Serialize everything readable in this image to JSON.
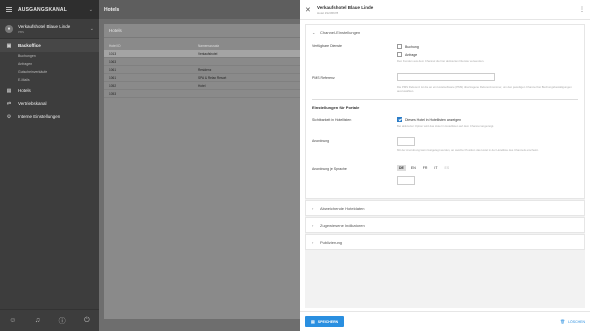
{
  "sidebar": {
    "title": "AUSGANGSKANAL",
    "hotel_name": "Verkaufshotel Blaue Linde",
    "hotel_sub": "PBS",
    "backoffice": "Backoffice",
    "sub_items": [
      "Buchungen",
      "Anfragen",
      "Gutscheinverkäufe",
      "E-Mails"
    ],
    "hotels": "Hotels",
    "vertriebskanal": "Vertriebskanal",
    "interne": "Interne Einstellungen"
  },
  "main": {
    "title": "Hotels",
    "card_title": "Hotels",
    "col_id": "Hotel ID",
    "col_name": "Namenszusatz",
    "rows": [
      {
        "id": "1013",
        "name": "Verkaufshotel"
      },
      {
        "id": "1063",
        "name": ""
      },
      {
        "id": "1061",
        "name": "Residenz"
      },
      {
        "id": "1061",
        "name": "SPA & Relax Resort"
      },
      {
        "id": "1052",
        "name": "Hotel"
      },
      {
        "id": "1053",
        "name": ""
      }
    ]
  },
  "panel": {
    "name": "Verkaufshotel Blaue Linde",
    "sub": "Hotel #1245678",
    "acc1": "Channel-Einstellungen",
    "verfuegbare_dienste": "Verfügbare Dienste",
    "opt_buchung": "Buchung",
    "opt_anfrage": "Anfrage",
    "dienste_hint": "Den Kunden aus dem Channel die hier aktivierten Dienste verwenden.",
    "pms_label": "PMS Referenz",
    "pms_hint": "Die PMS Referenz ist die an ein Hotelsoftware (PMS) übertragene Referenznummer, um den jeweiligen Channel bei Buchungsbestätigungen auszuwählen.",
    "portale_title": "Einstellungen für Portale",
    "sichtbarkeit_label": "Sichtbarkeit in Hotellisten",
    "sichtbarkeit_opt": "Dieses Hotel in Hotellisten anzeigen",
    "sichtbarkeit_hint": "Bei aktivierter Option wird das Hotel in Hotellisten auf dem Channel angezeigt.",
    "anordnung_label": "Anordnung",
    "anordnung_hint": "Mit der Anordnung kann festgelegt werden, an welcher Position das Hotel in der Hotelliste des Channels erscheint.",
    "anordnung_sprache_label": "Anordnung je Sprache",
    "langs": [
      "DE",
      "EN",
      "FR",
      "IT",
      "ES"
    ],
    "acc2": "Abweichende Hoteldaten",
    "acc3": "Zugewiesene Indikatoren",
    "acc4": "Publizierung",
    "save": "SPEICHERN",
    "delete": "LÖSCHEN"
  }
}
